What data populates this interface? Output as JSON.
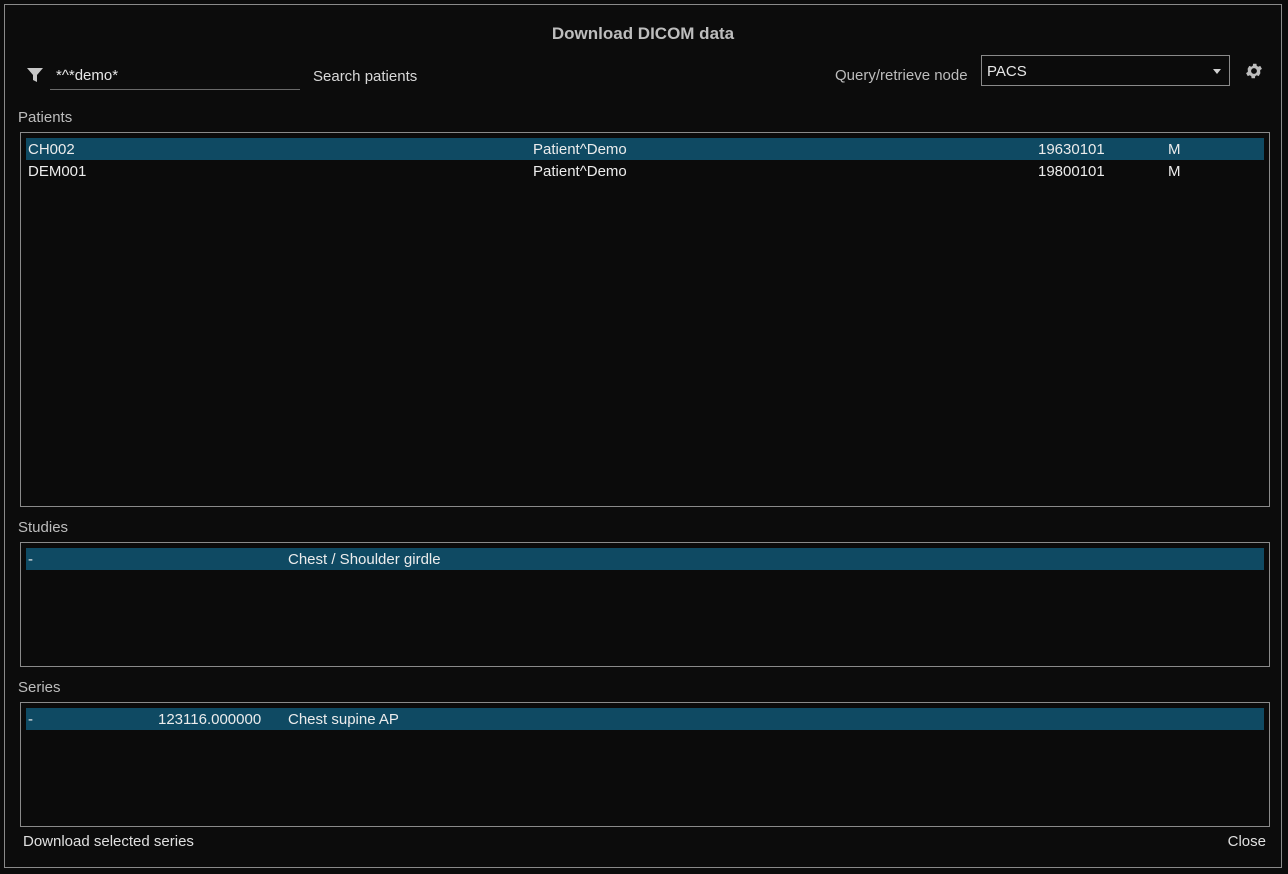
{
  "dialog": {
    "title": "Download DICOM data"
  },
  "search": {
    "value": "*^*demo*",
    "button_label": "Search patients"
  },
  "node": {
    "label": "Query/retrieve node",
    "selected": "PACS"
  },
  "icons": {
    "filter": "filter-icon",
    "settings": "gear-icon",
    "dropdown": "chevron-down-icon"
  },
  "colors": {
    "background": "#0c0c0c",
    "selection": "#0f4a63",
    "border": "#8a8a8a",
    "text": "#e6e6e6"
  },
  "patients": {
    "label": "Patients",
    "rows": [
      {
        "id": "CH002",
        "name": "Patient^Demo",
        "birthdate": "19630101",
        "sex": "M",
        "selected": true
      },
      {
        "id": "DEM001",
        "name": "Patient^Demo",
        "birthdate": "19800101",
        "sex": "M",
        "selected": false
      }
    ]
  },
  "studies": {
    "label": "Studies",
    "rows": [
      {
        "date": "-",
        "description": "Chest / Shoulder girdle",
        "selected": true
      }
    ]
  },
  "series": {
    "label": "Series",
    "rows": [
      {
        "date": "-",
        "time": "123116.000000",
        "description": "Chest supine AP",
        "selected": true
      }
    ]
  },
  "footer": {
    "download_label": "Download selected series",
    "close_label": "Close"
  }
}
